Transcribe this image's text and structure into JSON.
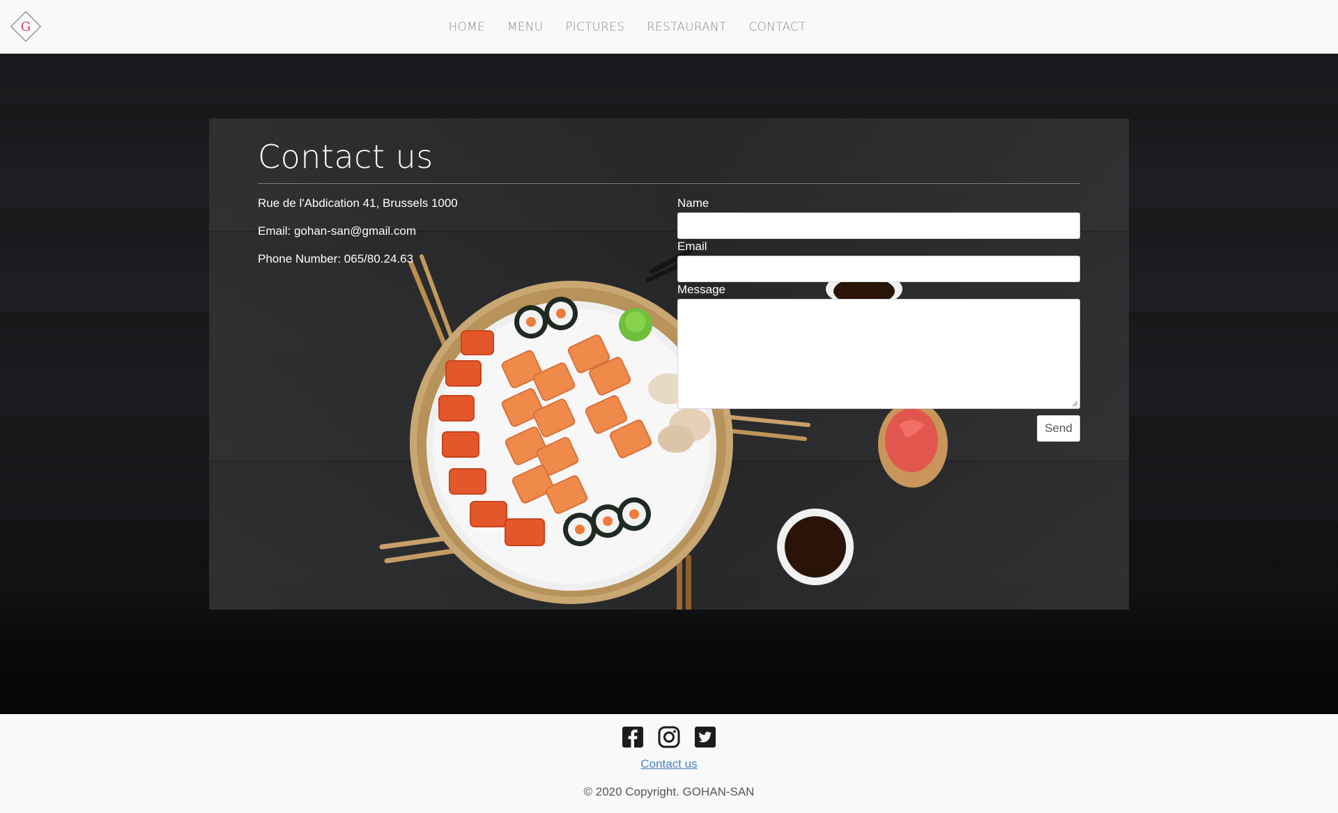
{
  "nav": {
    "logo_letter": "G",
    "items": [
      {
        "label": "HOME"
      },
      {
        "label": "MENU"
      },
      {
        "label": "PICTURES"
      },
      {
        "label": "RESTAURANT"
      },
      {
        "label": "CONTACT"
      }
    ]
  },
  "contact": {
    "title": "Contact us",
    "address": "Rue de l'Abdication 41, Brussels 1000",
    "email": "Email: gohan-san@gmail.com",
    "phone": "Phone Number: 065/80.24.63"
  },
  "form": {
    "name_label": "Name",
    "name_value": "",
    "email_label": "Email",
    "email_value": "",
    "message_label": "Message",
    "message_value": "",
    "send_label": "Send"
  },
  "footer": {
    "social_icons": [
      "facebook-icon",
      "instagram-icon",
      "twitter-icon"
    ],
    "link": "Contact us",
    "copyright": "© 2020 Copyright. GOHAN-SAN"
  },
  "colors": {
    "navbar_bg": "#f8f9fa",
    "hero_bg": "#18191c",
    "panel_bg": "#2a2b2d",
    "link_blue": "#4a7fc1",
    "logo_accent": "#d33b5c"
  }
}
